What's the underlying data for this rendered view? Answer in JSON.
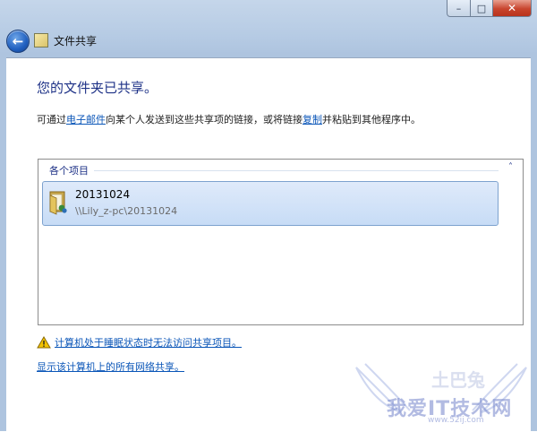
{
  "window": {
    "minimize_glyph": "–",
    "maximize_glyph": "□",
    "close_glyph": "✕"
  },
  "nav": {
    "back_glyph": "←",
    "title": "文件共享"
  },
  "main": {
    "heading": "您的文件夹已共享。",
    "desc_before": "可通过",
    "desc_email_link": "电子邮件",
    "desc_middle": "向某个人发送到这些共享项的链接，或将链接",
    "desc_copy_link": "复制",
    "desc_after": "并粘贴到其他程序中。"
  },
  "items": {
    "group_label": "各个项目",
    "collapse_glyph": "˄",
    "list": [
      {
        "name": "20131024",
        "path": "\\\\Lily_z-pc\\20131024",
        "selected": true
      }
    ]
  },
  "links": {
    "sleep_warning": "计算机处于睡眠状态时无法访问共享项目。",
    "show_all_shares": "显示该计算机上的所有网络共享。"
  },
  "watermark": {
    "top": "土巴兔",
    "main": "我爱IT技术网",
    "url": "www.52ij.com"
  },
  "colors": {
    "heading": "#1e3287",
    "link": "#0b56b8",
    "selection_fill": "#c7dcf6",
    "warning": "#f2c200"
  }
}
